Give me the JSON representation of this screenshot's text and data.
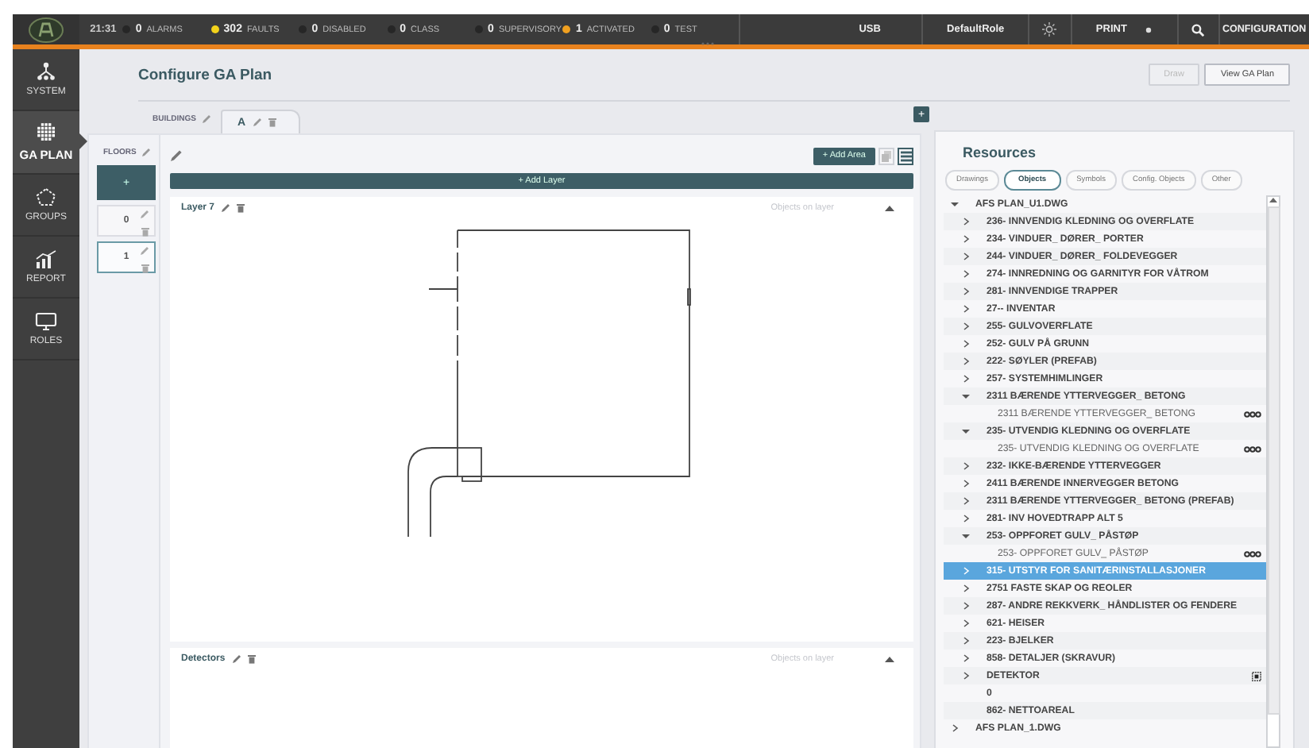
{
  "topbar": {
    "time": "21:31",
    "counters": [
      {
        "count": "0",
        "label": "ALARMS",
        "color": "#262626"
      },
      {
        "count": "302",
        "label": "FAULTS",
        "color": "#f2d21b"
      },
      {
        "count": "0",
        "label": "DISABLED",
        "color": "#262626"
      },
      {
        "count": "0",
        "label": "CLASS",
        "color": "#262626"
      },
      {
        "count": "0",
        "label": "SUPERVISORY",
        "color": "#262626"
      },
      {
        "count": "1",
        "label": "ACTIVATED",
        "color": "#f0a020"
      },
      {
        "count": "0",
        "label": "TEST",
        "color": "#262626"
      }
    ],
    "usb": "USB",
    "role": "DefaultRole",
    "print": "PRINT",
    "configuration": "CONFIGURATION"
  },
  "sidebar": {
    "items": [
      {
        "label": "SYSTEM",
        "kind": "system",
        "selected": false
      },
      {
        "label": "GA PLAN",
        "kind": "plan",
        "selected": true
      },
      {
        "label": "GROUPS",
        "kind": "groups",
        "selected": false
      },
      {
        "label": "REPORT",
        "kind": "report",
        "selected": false
      },
      {
        "label": "ROLES",
        "kind": "roles",
        "selected": false
      }
    ]
  },
  "page": {
    "title": "Configure GA Plan",
    "buttons": [
      {
        "label": "Draw",
        "disabled": true
      },
      {
        "label": "View GA Plan",
        "disabled": false
      }
    ]
  },
  "buildings": {
    "label": "BUILDINGS",
    "tabs": [
      {
        "label": "A",
        "selected": true
      }
    ],
    "add": "+"
  },
  "floors": {
    "label": "FLOORS",
    "add": "+",
    "items": [
      {
        "label": "0",
        "selected": false
      },
      {
        "label": "1",
        "selected": true
      }
    ]
  },
  "editor": {
    "add_area": "+ Add Area",
    "view_modes": [
      {
        "kind": "stack",
        "selected": false
      },
      {
        "kind": "list",
        "selected": true
      }
    ],
    "add_layer": "+ Add Layer",
    "layers": [
      {
        "name": "Layer 7",
        "objects": "Objects on layer",
        "kind": "drawing"
      },
      {
        "name": "Detectors",
        "objects": "Objects on layer",
        "kind": "empty"
      }
    ]
  },
  "resources": {
    "title": "Resources",
    "tabs": [
      {
        "label": "Drawings",
        "selected": false
      },
      {
        "label": "Objects",
        "selected": true
      },
      {
        "label": "Symbols",
        "selected": false
      },
      {
        "label": "Config. Objects",
        "selected": false
      },
      {
        "label": "Other",
        "selected": false
      }
    ],
    "tree": [
      {
        "label": "AFS PLAN_U1.DWG",
        "kind": "group",
        "expanded": true,
        "selected": false,
        "children": [
          {
            "label": "236- INNVENDIG KLEDNING OG OVERFLATE",
            "kind": "group",
            "expanded": false,
            "selected": false
          },
          {
            "label": "234- VINDUER_ DØRER_ PORTER",
            "kind": "group",
            "expanded": false,
            "selected": false
          },
          {
            "label": "244- VINDUER_ DØRER_ FOLDEVEGGER",
            "kind": "group",
            "expanded": false,
            "selected": false
          },
          {
            "label": "274- INNREDNING OG GARNITYR FOR VÅTROM",
            "kind": "group",
            "expanded": false,
            "selected": false
          },
          {
            "label": "281- INNVENDIGE TRAPPER",
            "kind": "group",
            "expanded": false,
            "selected": false
          },
          {
            "label": "27-- INVENTAR",
            "kind": "group",
            "expanded": false,
            "selected": false
          },
          {
            "label": "255- GULVOVERFLATE",
            "kind": "group",
            "expanded": false,
            "selected": false
          },
          {
            "label": "252- GULV PÅ GRUNN",
            "kind": "group",
            "expanded": false,
            "selected": false
          },
          {
            "label": "222- SØYLER (PREFAB)",
            "kind": "group",
            "expanded": false,
            "selected": false
          },
          {
            "label": "257- SYSTEMHIMLINGER",
            "kind": "group",
            "expanded": false,
            "selected": false
          },
          {
            "label": "2311 BÆRENDE YTTERVEGGER_ BETONG",
            "kind": "group",
            "expanded": true,
            "selected": false,
            "children": [
              {
                "label": "2311 BÆRENDE YTTERVEGGER_ BETONG",
                "kind": "layer",
                "selected": false
              }
            ]
          },
          {
            "label": "235- UTVENDIG KLEDNING OG OVERFLATE",
            "kind": "group",
            "expanded": true,
            "selected": false,
            "children": [
              {
                "label": "235- UTVENDIG KLEDNING OG OVERFLATE",
                "kind": "layer",
                "selected": false
              }
            ]
          },
          {
            "label": "232- IKKE-BÆRENDE YTTERVEGGER",
            "kind": "group",
            "expanded": false,
            "selected": false
          },
          {
            "label": "2411 BÆRENDE INNERVEGGER BETONG",
            "kind": "group",
            "expanded": false,
            "selected": false
          },
          {
            "label": "2311 BÆRENDE YTTERVEGGER_ BETONG (PREFAB)",
            "kind": "group",
            "expanded": false,
            "selected": false
          },
          {
            "label": "281- INV HOVEDTRAPP ALT 5",
            "kind": "group",
            "expanded": false,
            "selected": false
          },
          {
            "label": "253- OPPFORET GULV_ PÅSTØP",
            "kind": "group",
            "expanded": true,
            "selected": false,
            "children": [
              {
                "label": "253- OPPFORET GULV_ PÅSTØP",
                "kind": "layer",
                "selected": false
              }
            ]
          },
          {
            "label": "315- UTSTYR FOR SANITÆRINSTALLASJONER",
            "kind": "group",
            "expanded": false,
            "selected": true
          },
          {
            "label": "2751 FASTE SKAP OG REOLER",
            "kind": "group",
            "expanded": false,
            "selected": false
          },
          {
            "label": "287- ANDRE REKKVERK_ HÅNDLISTER OG FENDERE",
            "kind": "group",
            "expanded": false,
            "selected": false
          },
          {
            "label": "621- HEISER",
            "kind": "group",
            "expanded": false,
            "selected": false
          },
          {
            "label": "223- BJELKER",
            "kind": "group",
            "expanded": false,
            "selected": false
          },
          {
            "label": "858- DETALJER (SKRAVUR)",
            "kind": "group",
            "expanded": false,
            "selected": false
          },
          {
            "label": "DETEKTOR",
            "kind": "detector",
            "expanded": false,
            "selected": false
          },
          {
            "label": "0",
            "kind": "plain",
            "selected": false
          },
          {
            "label": "862- NETTOAREAL",
            "kind": "plain",
            "selected": false
          }
        ]
      },
      {
        "label": "AFS PLAN_1.DWG",
        "kind": "group",
        "expanded": false,
        "selected": false
      }
    ]
  }
}
